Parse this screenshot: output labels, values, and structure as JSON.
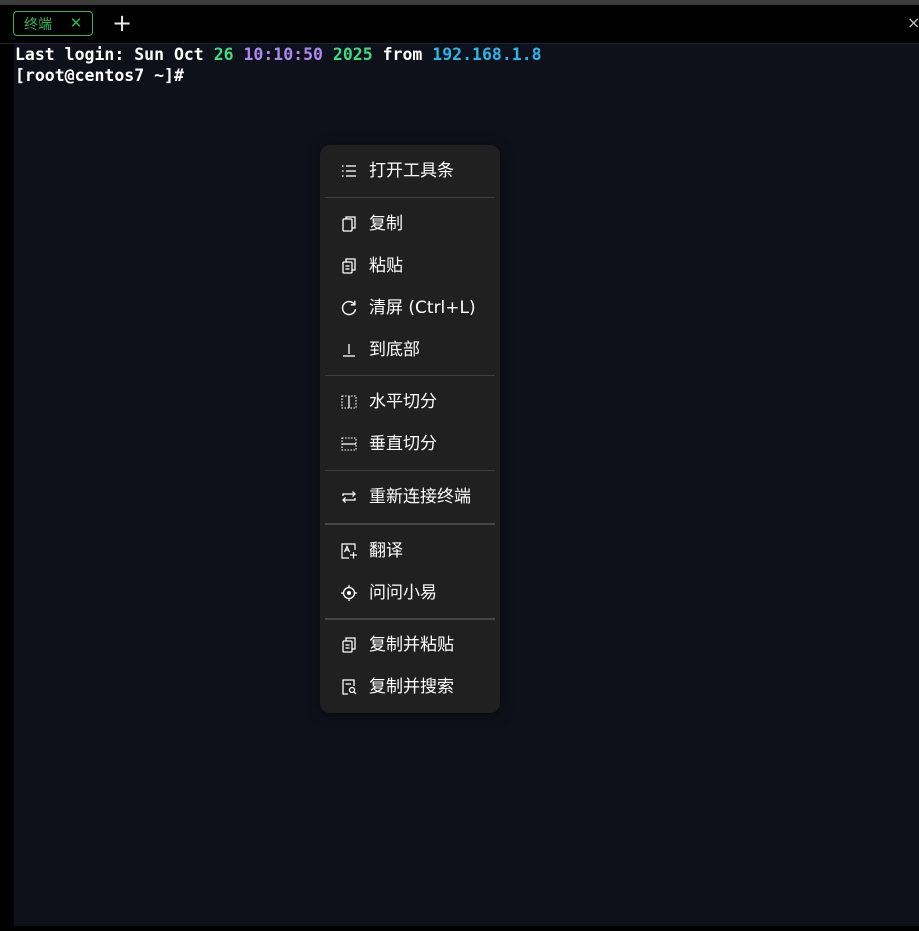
{
  "tabbar": {
    "tab_label": "终端",
    "close_glyph": "✕",
    "add_glyph": "+",
    "window_close_glyph": "×"
  },
  "terminal": {
    "line1": {
      "prefix": "Last login: Sun Oct ",
      "day": "26",
      "time": "10:10:50",
      "year": "2025",
      "from": "from",
      "ip": "192.168.1.8"
    },
    "prompt": "[root@centos7 ~]#"
  },
  "context_menu": {
    "items": [
      {
        "label": "打开工具条",
        "icon": "list-icon"
      },
      {
        "label": "复制",
        "icon": "copy-icon"
      },
      {
        "label": "粘贴",
        "icon": "paste-icon"
      },
      {
        "label": "清屏 (Ctrl+L)",
        "icon": "refresh-icon"
      },
      {
        "label": "到底部",
        "icon": "arrow-down-to-bottom-icon"
      },
      {
        "label": "水平切分",
        "icon": "split-horizontal-icon"
      },
      {
        "label": "垂直切分",
        "icon": "split-vertical-icon"
      },
      {
        "label": "重新连接终端",
        "icon": "reconnect-icon"
      },
      {
        "label": "翻译",
        "icon": "translate-icon"
      },
      {
        "label": "问问小易",
        "icon": "assistant-target-icon"
      },
      {
        "label": "复制并粘贴",
        "icon": "copy-paste-icon"
      },
      {
        "label": "复制并搜索",
        "icon": "copy-search-icon"
      }
    ]
  },
  "colors": {
    "tab_accent": "#2fb65a",
    "terminal_bg": "#0f111a",
    "menu_bg": "#202020",
    "green": "#3ddc84",
    "purple": "#a98bef",
    "cyan": "#29b6e8"
  }
}
